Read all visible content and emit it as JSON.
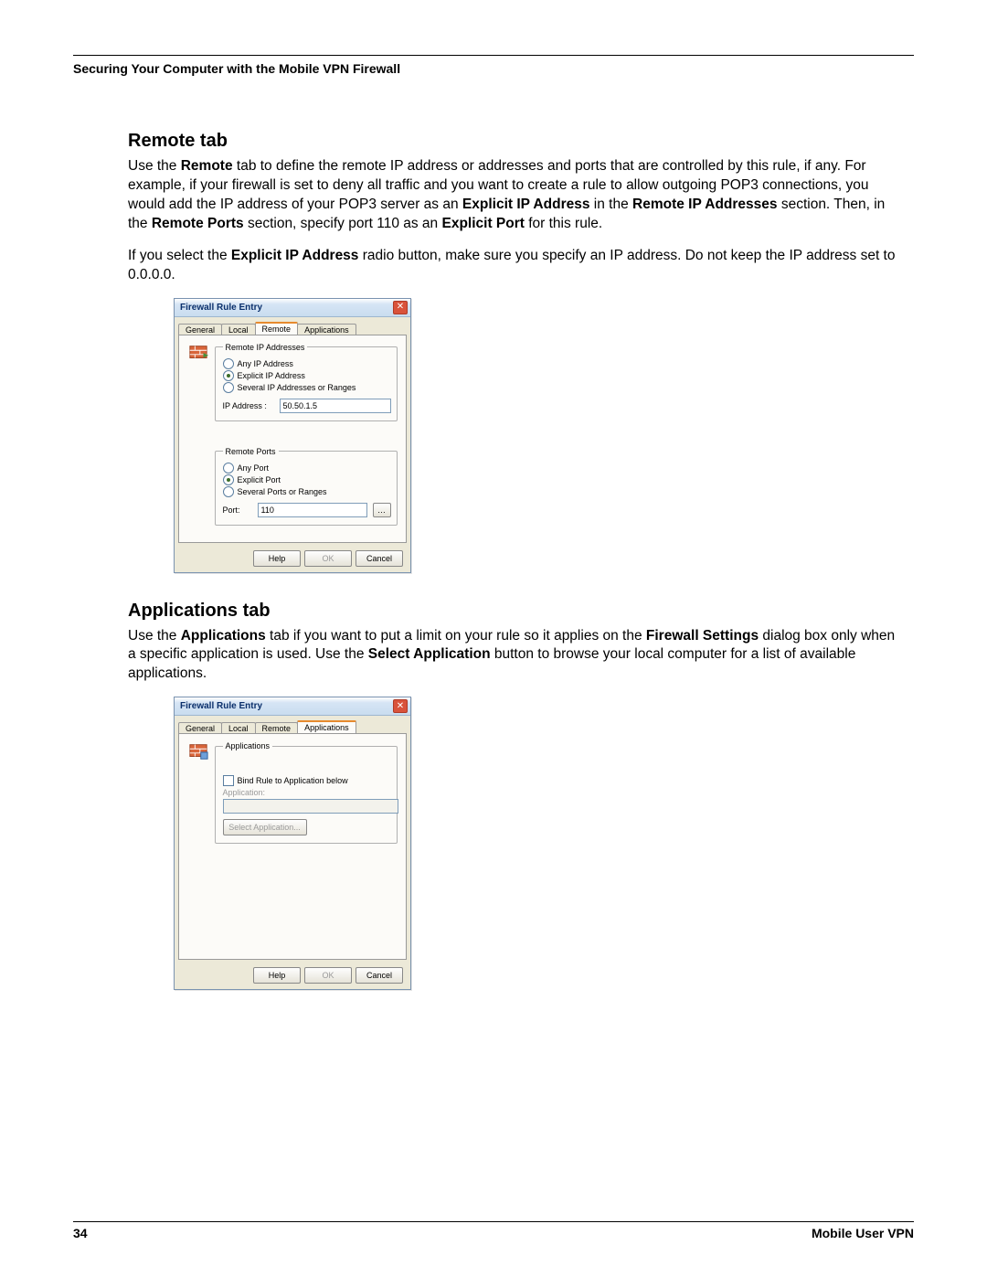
{
  "runningHead": "Securing Your Computer with the Mobile VPN Firewall",
  "sections": {
    "remote": {
      "title": "Remote tab",
      "para1_parts": [
        "Use the ",
        "Remote",
        " tab to define the remote IP address or addresses and ports that are controlled by this rule, if any. For example, if your firewall is set to deny all traffic and you want to create a rule to allow outgoing POP3 connections, you would add the IP address of your POP3 server as an ",
        "Explicit IP Address",
        " in the ",
        "Remote IP Addresses",
        " section. Then, in the ",
        "Remote Ports",
        " section, specify port 110 as an ",
        "Explicit Port",
        " for this rule."
      ],
      "para2_parts": [
        "If you select the ",
        "Explicit IP Address",
        " radio button, make sure you specify an IP address. Do not keep the IP address set to 0.0.0.0."
      ]
    },
    "apps": {
      "title": "Applications tab",
      "para1_parts": [
        "Use the ",
        "Applications",
        " tab if you want to put a limit on your rule so it applies on the ",
        "Firewall Settings",
        " dialog box only when a specific application is used. Use the ",
        "Select Application",
        " button to browse your local computer for a list of available applications."
      ]
    }
  },
  "dialog1": {
    "title": "Firewall Rule Entry",
    "tabs": [
      "General",
      "Local",
      "Remote",
      "Applications"
    ],
    "activeTab": "Remote",
    "ipGroup": {
      "legend": "Remote IP Addresses",
      "opts": [
        "Any IP Address",
        "Explicit IP Address",
        "Several IP Addresses or Ranges"
      ],
      "selected": 1,
      "ipLabel": "IP Address :",
      "ipValue": "50.50.1.5"
    },
    "portGroup": {
      "legend": "Remote Ports",
      "opts": [
        "Any Port",
        "Explicit Port",
        "Several Ports or Ranges"
      ],
      "selected": 1,
      "portLabel": "Port:",
      "portValue": "110"
    },
    "buttons": {
      "help": "Help",
      "ok": "OK",
      "cancel": "Cancel"
    }
  },
  "dialog2": {
    "title": "Firewall Rule Entry",
    "tabs": [
      "General",
      "Local",
      "Remote",
      "Applications"
    ],
    "activeTab": "Applications",
    "appGroup": {
      "legend": "Applications",
      "checkLabel": "Bind Rule to Application below",
      "fieldLabel": "Application:",
      "selectBtn": "Select Application..."
    },
    "buttons": {
      "help": "Help",
      "ok": "OK",
      "cancel": "Cancel"
    }
  },
  "footer": {
    "pageNum": "34",
    "bookTitle": "Mobile User VPN"
  }
}
